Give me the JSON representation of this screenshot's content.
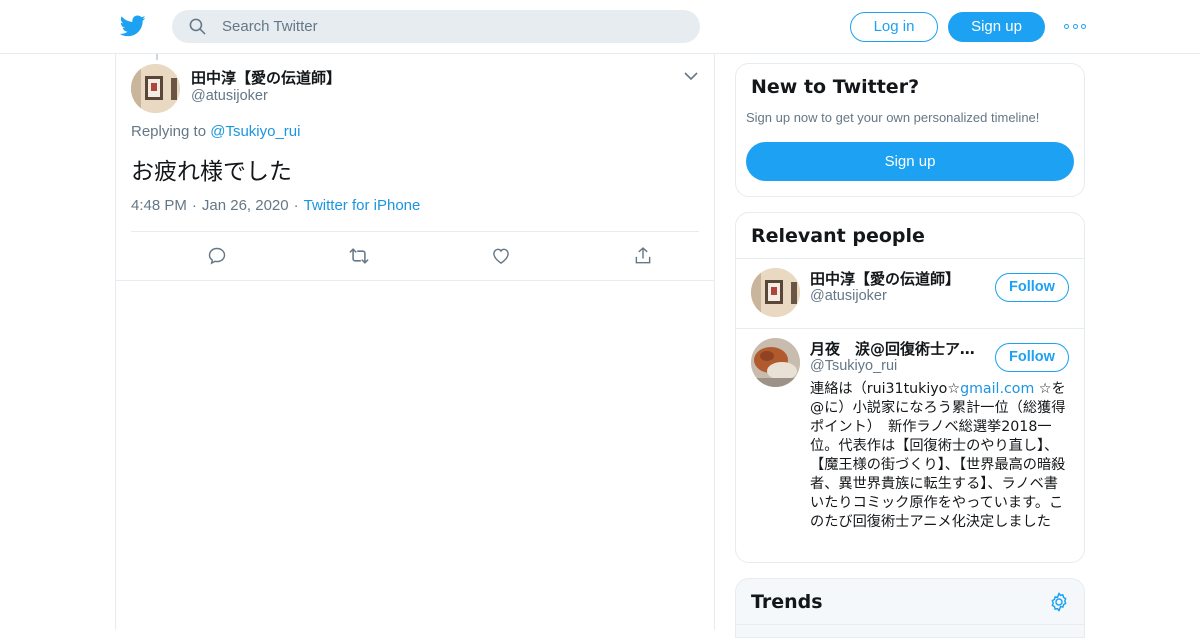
{
  "header": {
    "search_placeholder": "Search Twitter",
    "login_label": "Log in",
    "signup_label": "Sign up"
  },
  "tweet": {
    "author_name": "田中淳【愛の伝道師】",
    "author_handle": "@atusijoker",
    "replying_prefix": "Replying to",
    "replying_to": "@Tsukiyo_rui",
    "text": "お疲れ様でした",
    "time": "4:48 PM",
    "date": "Jan 26, 2020",
    "source": "Twitter for iPhone"
  },
  "new_to_twitter": {
    "title": "New to Twitter?",
    "subtitle": "Sign up now to get your own personalized timeline!",
    "signup_label": "Sign up"
  },
  "relevant_people": {
    "title": "Relevant people",
    "follow_label": "Follow",
    "people": [
      {
        "name": "田中淳【愛の伝道師】",
        "handle": "@atusijoker"
      },
      {
        "name": "月夜　涙@回復術士アニメ化決定",
        "handle": "@Tsukiyo_rui",
        "bio_pre": "連絡は（rui31tukiyo☆",
        "bio_link": "gmail.com",
        "bio_post": " ☆を@に）小説家になろう累計一位（総獲得ポイント）　新作ラノベ総選挙2018一位。代表作は【回復術士のやり直し】、【魔王様の街づくり】、【世界最高の暗殺者、異世界貴族に転生する】、ラノベ書いたりコミック原作をやっています。このたび回復術士アニメ化決定しました"
      }
    ]
  },
  "trends": {
    "title": "Trends"
  },
  "colors": {
    "accent": "#1da1f2",
    "link": "#1b95e0",
    "muted": "#657786",
    "border": "#e6ecf0"
  }
}
